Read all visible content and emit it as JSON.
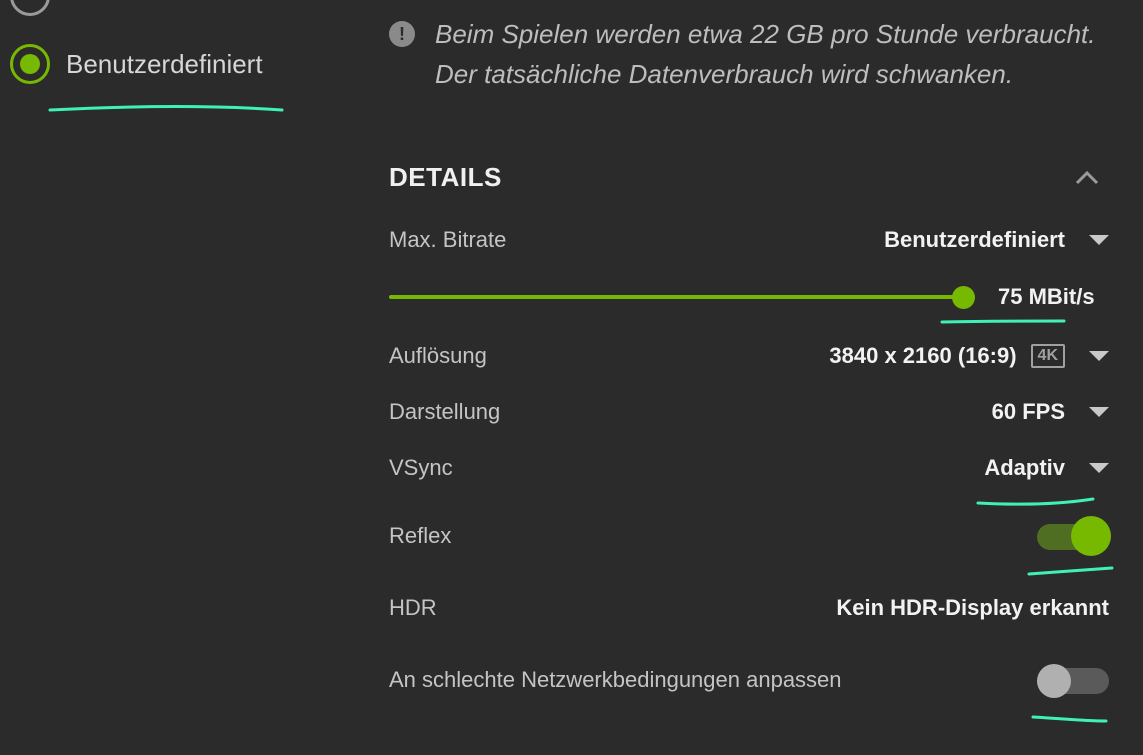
{
  "quality_options": {
    "selected_label": "Benutzerdefiniert"
  },
  "info": {
    "icon": "exclamation-icon",
    "text": "Beim Spielen werden etwa 22 GB pro Stunde verbraucht. Der tatsächliche Datenverbrauch wird schwanken."
  },
  "details": {
    "title": "DETAILS",
    "max_bitrate": {
      "label": "Max. Bitrate",
      "value": "Benutzerdefiniert"
    },
    "bitrate_slider": {
      "value_label": "75 MBit/s",
      "fill_fraction": 1.0
    },
    "resolution": {
      "label": "Auflösung",
      "value": "3840 x 2160 (16:9)",
      "badge": "4K"
    },
    "framerate": {
      "label": "Darstellung",
      "value": "60 FPS"
    },
    "vsync": {
      "label": "VSync",
      "value": "Adaptiv"
    },
    "reflex": {
      "label": "Reflex",
      "enabled": true
    },
    "hdr": {
      "label": "HDR",
      "value": "Kein HDR-Display erkannt"
    },
    "network": {
      "label": "An schlechte Netzwerkbedingungen anpassen",
      "enabled": false
    }
  },
  "colors": {
    "accent": "#76b900",
    "annotation": "#3ff0b8",
    "background": "#2b2b2b"
  }
}
